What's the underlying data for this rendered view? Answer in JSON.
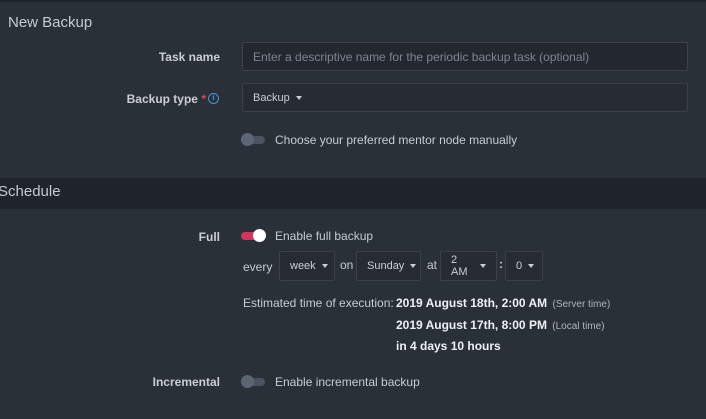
{
  "new_backup": {
    "title": "New Backup",
    "task_name": {
      "label": "Task name",
      "value": "",
      "placeholder": "Enter a descriptive name for the periodic backup task (optional)"
    },
    "backup_type": {
      "label": "Backup type",
      "required_mark": "*",
      "info_icon": "info-icon",
      "selected": "Backup"
    },
    "mentor_toggle": {
      "label": "Choose your preferred mentor node manually",
      "enabled": false
    }
  },
  "schedule": {
    "title": "Schedule",
    "full": {
      "label": "Full",
      "toggle_label": "Enable full backup",
      "enabled": true,
      "every_text": "every",
      "period": "week",
      "on_text": "on",
      "day": "Sunday",
      "at_text": "at",
      "hour": "2 AM",
      "separator": ":",
      "minute": "0",
      "estimated": {
        "label": "Estimated time of execution:",
        "server_time": "2019 August 18th, 2:00 AM",
        "server_note": "(Server time)",
        "local_time": "2019 August 17th, 8:00 PM",
        "local_note": "(Local time)",
        "relative": "in 4 days 10 hours"
      }
    },
    "incremental": {
      "label": "Incremental",
      "toggle_label": "Enable incremental backup",
      "enabled": false
    }
  },
  "colors": {
    "background": "#2a3038",
    "band": "#1f242b",
    "toggle_on": "#d6335c",
    "required": "#e0405e",
    "info": "#4a90d9"
  }
}
